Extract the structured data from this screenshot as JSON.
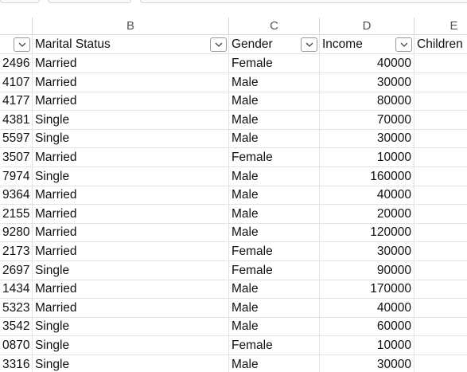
{
  "columns": [
    {
      "letter": "B"
    },
    {
      "letter": "C"
    },
    {
      "letter": "D"
    },
    {
      "letter": "E"
    }
  ],
  "table": {
    "headers": [
      "Marital Status",
      "Gender",
      "Income",
      "Children"
    ],
    "rows": [
      {
        "id": "2496",
        "marital": "Married",
        "gender": "Female",
        "income": "40000"
      },
      {
        "id": "4107",
        "marital": "Married",
        "gender": "Male",
        "income": "30000"
      },
      {
        "id": "4177",
        "marital": "Married",
        "gender": "Male",
        "income": "80000"
      },
      {
        "id": "4381",
        "marital": "Single",
        "gender": "Male",
        "income": "70000"
      },
      {
        "id": "5597",
        "marital": "Single",
        "gender": "Male",
        "income": "30000"
      },
      {
        "id": "3507",
        "marital": "Married",
        "gender": "Female",
        "income": "10000"
      },
      {
        "id": "7974",
        "marital": "Single",
        "gender": "Male",
        "income": "160000"
      },
      {
        "id": "9364",
        "marital": "Married",
        "gender": "Male",
        "income": "40000"
      },
      {
        "id": "2155",
        "marital": "Married",
        "gender": "Male",
        "income": "20000"
      },
      {
        "id": "9280",
        "marital": "Married",
        "gender": "Male",
        "income": "120000"
      },
      {
        "id": "2173",
        "marital": "Married",
        "gender": "Female",
        "income": "30000"
      },
      {
        "id": "2697",
        "marital": "Single",
        "gender": "Female",
        "income": "90000"
      },
      {
        "id": "1434",
        "marital": "Married",
        "gender": "Male",
        "income": "170000"
      },
      {
        "id": "5323",
        "marital": "Married",
        "gender": "Male",
        "income": "40000"
      },
      {
        "id": "3542",
        "marital": "Single",
        "gender": "Male",
        "income": "60000"
      },
      {
        "id": "0870",
        "marital": "Single",
        "gender": "Female",
        "income": "10000"
      },
      {
        "id": "3316",
        "marital": "Single",
        "gender": "Male",
        "income": "30000"
      }
    ]
  },
  "icons": {
    "filter": "filter-dropdown-icon"
  },
  "colors": {
    "gridline": "#e3e3e3",
    "header_border": "#d6d6d6"
  }
}
